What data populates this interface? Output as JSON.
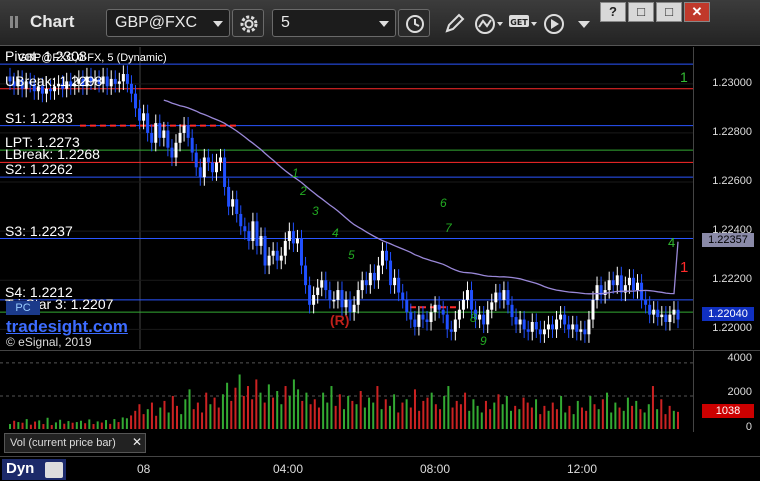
{
  "toolbar": {
    "title": "Chart",
    "symbol": "GBP@FXC",
    "interval": "5",
    "window_buttons": [
      "?",
      "□",
      "□",
      "✕"
    ]
  },
  "chart": {
    "header": "GBP@FXC,0-FX, 5 (Dynamic)",
    "levels": [
      {
        "label": "Pivot: 1.2308",
        "price": 1.2308,
        "color": "#2a55ff",
        "style": "solid"
      },
      {
        "label": "UBreak: 1.2298",
        "price": 1.2298,
        "color": "#ff2a2a",
        "style": "solid"
      },
      {
        "label": "S1: 1.2283",
        "price": 1.2283,
        "color": "#2a55ff",
        "style": "solid"
      },
      {
        "label": "LPT: 1.2273",
        "price": 1.2273,
        "color": "#33aa33",
        "style": "solid"
      },
      {
        "label": "LBreak: 1.2268",
        "price": 1.2268,
        "color": "#ff2a2a",
        "style": "solid"
      },
      {
        "label": "S2: 1.2262",
        "price": 1.2262,
        "color": "#2a55ff",
        "style": "solid"
      },
      {
        "label": "S3: 1.2237",
        "price": 1.2237,
        "color": "#2a55ff",
        "style": "solid"
      },
      {
        "label": "S4: 1.2212",
        "price": 1.2212,
        "color": "#2a55ff",
        "style": "solid"
      },
      {
        "label": "Tri-Star 3: 1.2207",
        "price": 1.2207,
        "color": "#33aa33",
        "style": "solid"
      }
    ],
    "watermark": "tradesight.com",
    "copyright": "© eSignal, 2019",
    "pc_label": "PC",
    "r_marker": "(R)",
    "price_axis": [
      "1.23000",
      "1.22800",
      "1.22600",
      "1.22400",
      "1.22200",
      "1.22000"
    ],
    "price_tags": [
      {
        "text": "1.22357",
        "bg": "#8a8aa8",
        "fg": "#000"
      },
      {
        "text": "1.22040",
        "bg": "#1030c0",
        "fg": "#fff"
      }
    ],
    "counters": [
      "1",
      "4",
      "1"
    ],
    "colors": {
      "up_bar": "#ffffff",
      "down_bar": "#2050ff",
      "ma_line": "#9a88d8",
      "seq_green": "#22aa22"
    }
  },
  "volume": {
    "caption": "Vol (current price bar)",
    "axis": [
      "4000",
      "2000",
      "0"
    ],
    "current_tag": "1038",
    "tag_color": "#cc0000"
  },
  "time_axis": {
    "labels": [
      "08",
      "04:00",
      "08:00",
      "12:00"
    ],
    "mode": "Dyn"
  },
  "chart_data": {
    "type": "candlestick",
    "x_ticks": [
      "08",
      "04:00",
      "08:00",
      "12:00"
    ],
    "y_ticks": [
      1.23,
      1.228,
      1.226,
      1.224,
      1.222,
      1.22
    ],
    "ylim": [
      1.2192,
      1.2315
    ],
    "last_price": 1.2204,
    "ma_last": 1.22357,
    "closes": [
      1.2301,
      1.2299,
      1.2302,
      1.2298,
      1.2301,
      1.23,
      1.2297,
      1.2299,
      1.2296,
      1.2298,
      1.2297,
      1.2299,
      1.23,
      1.2298,
      1.2301,
      1.2299,
      1.23,
      1.2302,
      1.2299,
      1.2303,
      1.2301,
      1.2302,
      1.23,
      1.2303,
      1.2299,
      1.2302,
      1.23,
      1.2301,
      1.2304,
      1.23,
      1.2296,
      1.229,
      1.2285,
      1.2288,
      1.228,
      1.2276,
      1.2284,
      1.2278,
      1.2281,
      1.2274,
      1.227,
      1.2276,
      1.228,
      1.2283,
      1.2278,
      1.2272,
      1.2266,
      1.2262,
      1.227,
      1.2268,
      1.2264,
      1.2268,
      1.227,
      1.2258,
      1.225,
      1.2253,
      1.2247,
      1.2242,
      1.224,
      1.2236,
      1.2244,
      1.2234,
      1.2238,
      1.2226,
      1.223,
      1.2232,
      1.2228,
      1.223,
      1.2236,
      1.224,
      1.2235,
      1.2237,
      1.2226,
      1.2218,
      1.221,
      1.2214,
      1.2217,
      1.222,
      1.2216,
      1.2212,
      1.2212,
      1.2216,
      1.2209,
      1.2212,
      1.2207,
      1.221,
      1.2216,
      1.222,
      1.2218,
      1.2223,
      1.222,
      1.2226,
      1.2232,
      1.2228,
      1.2218,
      1.2221,
      1.2215,
      1.2212,
      1.2207,
      1.2204,
      1.2201,
      1.2206,
      1.2204,
      1.2203,
      1.2207,
      1.221,
      1.2208,
      1.2206,
      1.22,
      1.2199,
      1.2204,
      1.2208,
      1.2212,
      1.2216,
      1.2208,
      1.2204,
      1.2206,
      1.2202,
      1.2208,
      1.2211,
      1.2215,
      1.2212,
      1.2216,
      1.221,
      1.2205,
      1.2202,
      1.2204,
      1.22,
      1.2199,
      1.2203,
      1.22,
      1.2198,
      1.22,
      1.2202,
      1.22,
      1.2204,
      1.2206,
      1.2202,
      1.22,
      1.2202,
      1.2199,
      1.22,
      1.2198,
      1.2204,
      1.2212,
      1.2218,
      1.2214,
      1.2216,
      1.222,
      1.2218,
      1.2222,
      1.2215,
      1.2218,
      1.2221,
      1.2216,
      1.2219,
      1.2212,
      1.221,
      1.2206,
      1.2208,
      1.2205,
      1.2206,
      1.2203,
      1.2206,
      1.2208,
      1.2204
    ],
    "volumes": [
      300,
      500,
      420,
      380,
      600,
      260,
      450,
      520,
      300,
      680,
      240,
      400,
      560,
      320,
      480,
      380,
      420,
      500,
      350,
      580,
      300,
      460,
      390,
      540,
      310,
      600,
      420,
      700,
      650,
      820,
      1100,
      1500,
      900,
      1200,
      1600,
      800,
      1300,
      1700,
      1000,
      2000,
      1400,
      900,
      1800,
      2400,
      1200,
      1600,
      1000,
      2200,
      1500,
      1900,
      1300,
      2100,
      2800,
      1700,
      2500,
      3300,
      2000,
      2600,
      1800,
      3000,
      2200,
      1600,
      2700,
      1900,
      2300,
      1500,
      2600,
      2000,
      3000,
      2400,
      1700,
      2200,
      1500,
      1800,
      1300,
      2200,
      1600,
      2600,
      1400,
      2100,
      1200,
      2000,
      1700,
      1500,
      2300,
      1300,
      1900,
      1600,
      2600,
      1200,
      1800,
      1400,
      2100,
      1000,
      1600,
      1800,
      1300,
      2400,
      1100,
      1700,
      1900,
      2200,
      1500,
      1200,
      2000,
      2600,
      1300,
      1700,
      1500,
      2200,
      1100,
      1800,
      1400,
      1000,
      1700,
      1200,
      1600,
      2100,
      1500,
      2000,
      1100,
      1400,
      1200,
      1900,
      1600,
      1300,
      1800,
      900,
      1400,
      1100,
      1600,
      1200,
      2000,
      1000,
      1400,
      900,
      1700,
      1300,
      1100,
      2000,
      1500,
      1200,
      1800,
      2200,
      1000,
      1600,
      1300,
      1100,
      1900,
      1400,
      1700,
      1200,
      1000,
      1500,
      2600,
      1200,
      1800,
      900,
      1400,
      1100,
      1038
    ]
  }
}
